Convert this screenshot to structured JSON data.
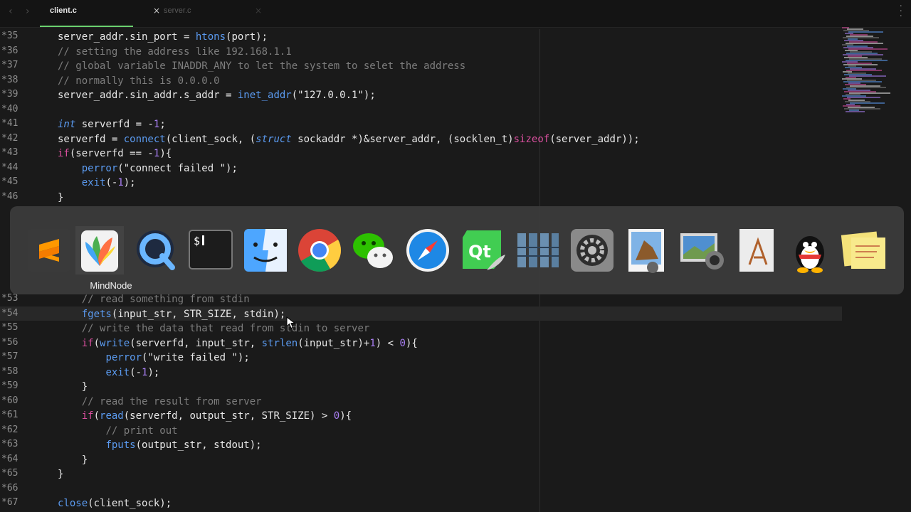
{
  "tabs": [
    {
      "label": "client.c",
      "active": true,
      "close": "×"
    },
    {
      "label": "server.c",
      "active": false,
      "close": "×"
    }
  ],
  "dock": {
    "hover_label": "MindNode",
    "apps": [
      "Sublime Text",
      "MindNode",
      "QuickTime Player",
      "Terminal",
      "Finder",
      "Google Chrome",
      "WeChat",
      "Safari",
      "Qt Creator",
      "Activity Monitor",
      "System Preferences",
      "Preview",
      "Image Capture",
      "TextEdit",
      "QQ",
      "Stickies"
    ]
  },
  "colors": {
    "background": "#1a1a1a",
    "text": "#e8e8e8",
    "comment": "#7d7d7d",
    "keyword": "#d94f9e",
    "function": "#5b9bf1",
    "number": "#a97ff3",
    "string": "#e8e8e8",
    "tab_accent": "#6bd16f"
  },
  "editor": {
    "lines": [
      {
        "n": "35",
        "code": "server_addr.sin_port = htons(port);"
      },
      {
        "n": "36",
        "code": "// setting the address like 192.168.1.1"
      },
      {
        "n": "37",
        "code": "// global variable INADDR_ANY to let the system to selet the address"
      },
      {
        "n": "38",
        "code": "// normally this is 0.0.0.0"
      },
      {
        "n": "39",
        "code": "server_addr.sin_addr.s_addr = inet_addr(\"127.0.0.1\");"
      },
      {
        "n": "40",
        "code": ""
      },
      {
        "n": "41",
        "code": "int serverfd = -1;"
      },
      {
        "n": "42",
        "code": "serverfd = connect(client_sock, (struct sockaddr *)&server_addr, (socklen_t)sizeof(server_addr));"
      },
      {
        "n": "43",
        "code": "if(serverfd == -1){"
      },
      {
        "n": "44",
        "code": "    perror(\"connect failed \");"
      },
      {
        "n": "45",
        "code": "    exit(-1);"
      },
      {
        "n": "46",
        "code": "}"
      },
      {
        "n": "53",
        "code": "    // read something from stdin"
      },
      {
        "n": "54",
        "code": "    fgets(input_str, STR_SIZE, stdin);"
      },
      {
        "n": "55",
        "code": "    // write the data that read from stdin to server"
      },
      {
        "n": "56",
        "code": "    if(write(serverfd, input_str, strlen(input_str)+1) < 0){"
      },
      {
        "n": "57",
        "code": "        perror(\"write failed \");"
      },
      {
        "n": "58",
        "code": "        exit(-1);"
      },
      {
        "n": "59",
        "code": "    }"
      },
      {
        "n": "60",
        "code": "    // read the result from server"
      },
      {
        "n": "61",
        "code": "    if(read(serverfd, output_str, STR_SIZE) > 0){"
      },
      {
        "n": "62",
        "code": "        // print out"
      },
      {
        "n": "63",
        "code": "        fputs(output_str, stdout);"
      },
      {
        "n": "64",
        "code": "    }"
      },
      {
        "n": "65",
        "code": "}"
      },
      {
        "n": "66",
        "code": ""
      },
      {
        "n": "67",
        "code": "close(client_sock);"
      }
    ]
  }
}
